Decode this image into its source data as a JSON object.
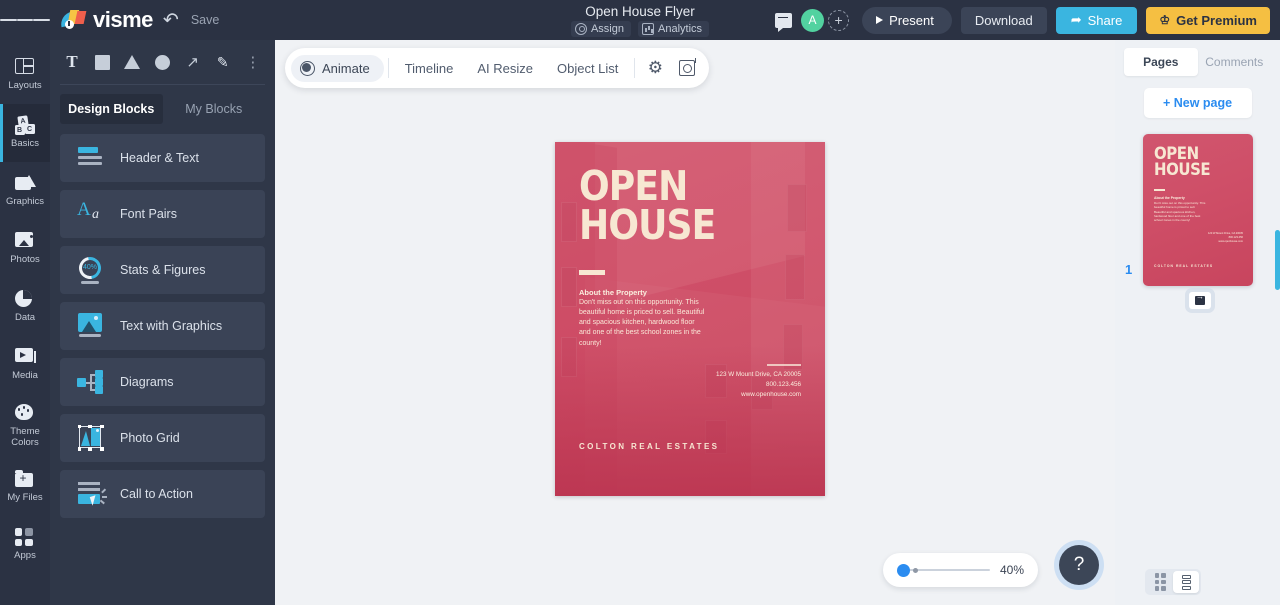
{
  "topbar": {
    "menu_icon": "hamburger-icon",
    "logo_text": "visme",
    "undo_icon": "undo-arrow-icon",
    "save_label": "Save",
    "doc_title": "Open House Flyer",
    "assign_label": "Assign",
    "analytics_label": "Analytics",
    "comment_icon": "comment-icon",
    "avatar_initial": "A",
    "add_user_icon": "add-user-icon",
    "present_label": "Present",
    "download_label": "Download",
    "share_label": "Share",
    "premium_label": "Get Premium",
    "accent_blue": "#3ab5e0",
    "accent_gold": "#f5bf42",
    "bar_bg": "#2b3243"
  },
  "rail": {
    "items": [
      {
        "label": "Layouts",
        "icon": "layouts-icon",
        "active": false
      },
      {
        "label": "Basics",
        "icon": "basics-icon",
        "active": true
      },
      {
        "label": "Graphics",
        "icon": "graphics-icon",
        "active": false
      },
      {
        "label": "Photos",
        "icon": "photos-icon",
        "active": false
      },
      {
        "label": "Data",
        "icon": "data-icon",
        "active": false
      },
      {
        "label": "Media",
        "icon": "media-icon",
        "active": false
      },
      {
        "label": "Theme Colors",
        "icon": "theme-colors-icon",
        "active": false
      },
      {
        "label": "My Files",
        "icon": "my-files-icon",
        "active": false
      },
      {
        "label": "Apps",
        "icon": "apps-icon",
        "active": false
      }
    ],
    "theme_line1": "Theme",
    "theme_line2": "Colors",
    "myfiles_label": "My Files"
  },
  "panel": {
    "tools": [
      "text-tool",
      "square-tool",
      "triangle-tool",
      "circle-tool",
      "line-tool",
      "pen-tool",
      "more-tools"
    ],
    "tab_design_blocks": "Design Blocks",
    "tab_my_blocks": "My Blocks",
    "blocks": [
      {
        "label": "Header & Text",
        "icon": "header-text-icon"
      },
      {
        "label": "Font Pairs",
        "icon": "font-pairs-icon"
      },
      {
        "label": "Stats & Figures",
        "icon": "stats-figures-icon"
      },
      {
        "label": "Text with Graphics",
        "icon": "text-with-graphics-icon"
      },
      {
        "label": "Diagrams",
        "icon": "diagrams-icon"
      },
      {
        "label": "Photo Grid",
        "icon": "photo-grid-icon"
      },
      {
        "label": "Call to Action",
        "icon": "call-to-action-icon"
      }
    ],
    "stats_badge": "40%",
    "font_pairs_big": "A",
    "font_pairs_small": "a"
  },
  "float_toolbar": {
    "animate_label": "Animate",
    "timeline_label": "Timeline",
    "ai_resize_label": "AI Resize",
    "object_list_label": "Object List",
    "settings_icon": "gear-icon",
    "preview_icon": "magnify-box-icon"
  },
  "flyer": {
    "title_line1": "OPEN",
    "title_line2": "HOUSE",
    "subheading": "About the Property",
    "body": "Don't miss out on this opportunity. This beautiful home is priced to sell. Beautiful and spacious kitchen, hardwood floor and one of the best school zones in the county!",
    "address": "123 W Mount Drive, CA 20005",
    "phone": "800.123.456",
    "website": "www.openhouse.com",
    "footer": "COLTON REAL ESTATES",
    "bg_color": "#cf4f68",
    "text_color": "#f7e7d2"
  },
  "zoom": {
    "value": "40%",
    "help_label": "?"
  },
  "right_panel": {
    "tab_pages": "Pages",
    "tab_comments": "Comments",
    "new_page_label": "+ New page",
    "page_number": "1",
    "add_page_icon": "insert-page-icon",
    "view_grid_icon": "grid-view-icon",
    "view_list_icon": "list-view-icon"
  }
}
